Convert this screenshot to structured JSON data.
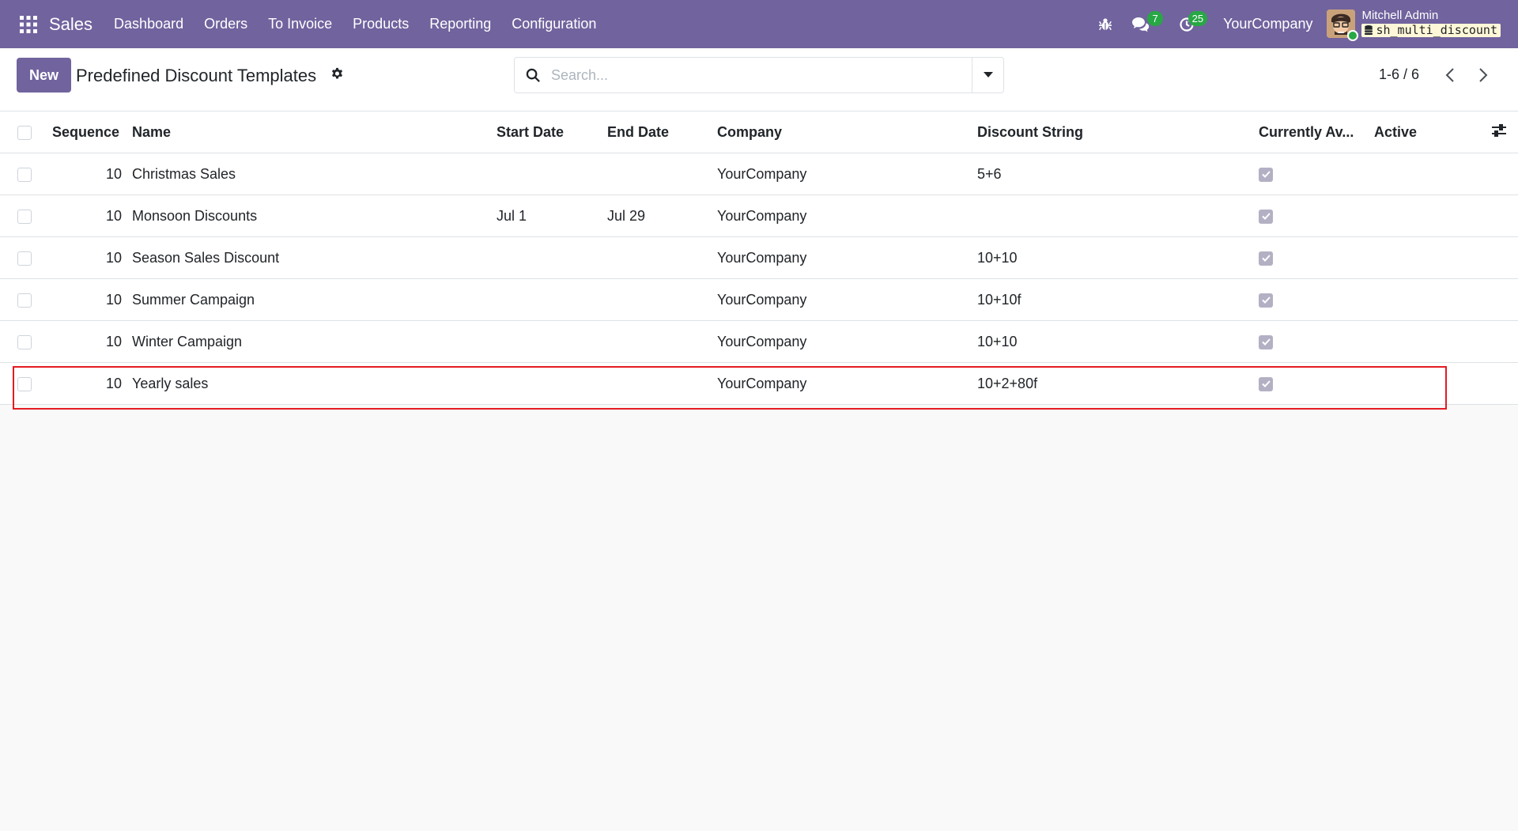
{
  "navbar": {
    "app_name": "Sales",
    "menu": [
      "Dashboard",
      "Orders",
      "To Invoice",
      "Products",
      "Reporting",
      "Configuration"
    ],
    "messages_count": "7",
    "activities_count": "25",
    "company": "YourCompany",
    "user_name": "Mitchell Admin",
    "database": "sh_multi_discount",
    "brand_color": "#71639e"
  },
  "control_panel": {
    "new_label": "New",
    "title": "Predefined Discount Templates",
    "search_placeholder": "Search...",
    "pager": "1-6 / 6"
  },
  "table": {
    "columns": [
      "Sequence",
      "Name",
      "Start Date",
      "End Date",
      "Company",
      "Discount String",
      "Currently Av...",
      "Active"
    ],
    "rows": [
      {
        "sequence": "10",
        "name": "Christmas Sales",
        "start_date": "",
        "end_date": "",
        "company": "YourCompany",
        "discount_string": "5+6",
        "currently_available": true
      },
      {
        "sequence": "10",
        "name": "Monsoon Discounts",
        "start_date": "Jul 1",
        "end_date": "Jul 29",
        "company": "YourCompany",
        "discount_string": "",
        "currently_available": true
      },
      {
        "sequence": "10",
        "name": "Season Sales Discount",
        "start_date": "",
        "end_date": "",
        "company": "YourCompany",
        "discount_string": "10+10",
        "currently_available": true
      },
      {
        "sequence": "10",
        "name": "Summer Campaign",
        "start_date": "",
        "end_date": "",
        "company": "YourCompany",
        "discount_string": "10+10f",
        "currently_available": true
      },
      {
        "sequence": "10",
        "name": "Winter Campaign",
        "start_date": "",
        "end_date": "",
        "company": "YourCompany",
        "discount_string": "10+10",
        "currently_available": true
      },
      {
        "sequence": "10",
        "name": "Yearly sales",
        "start_date": "",
        "end_date": "",
        "company": "YourCompany",
        "discount_string": "10+2+80f",
        "currently_available": true
      }
    ]
  },
  "annotation": {
    "highlighted_row": "Yearly sales",
    "highlight_color": "#e41b23"
  }
}
